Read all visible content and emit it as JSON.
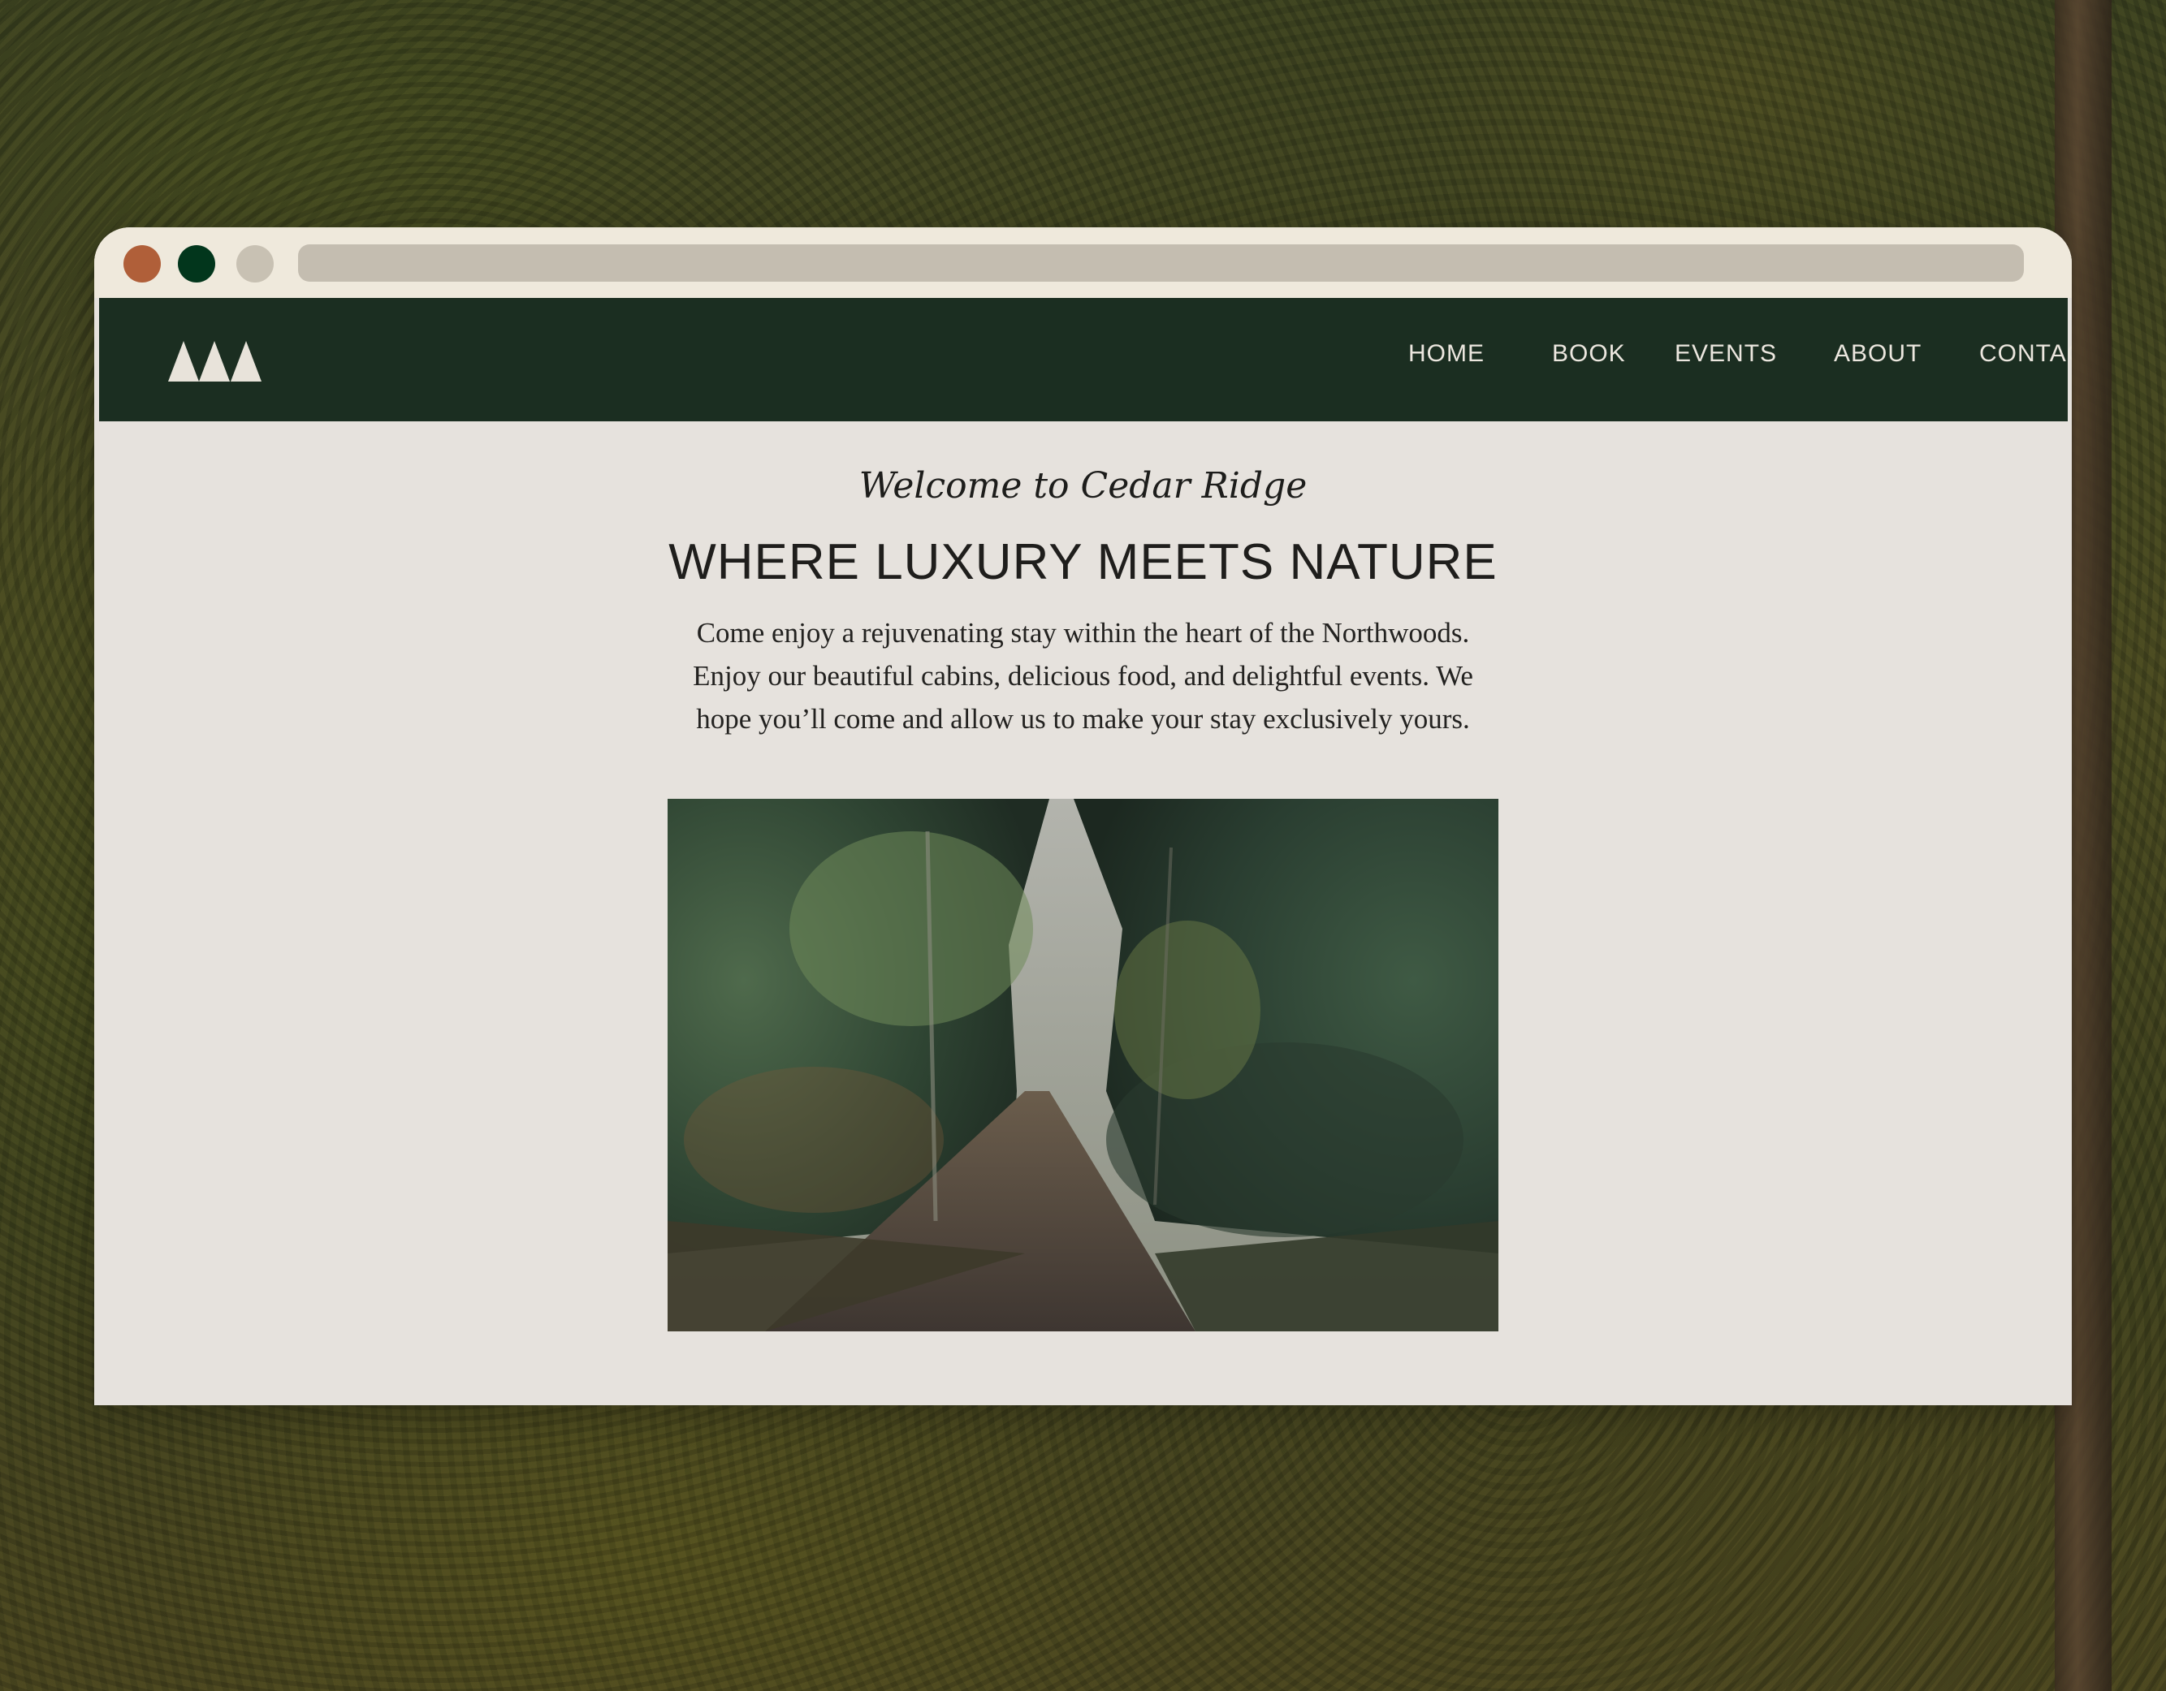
{
  "nav": {
    "items": [
      {
        "label": "HOME"
      },
      {
        "label": "BOOK"
      },
      {
        "label": "EVENTS"
      },
      {
        "label": "ABOUT"
      },
      {
        "label": "CONTACT"
      }
    ]
  },
  "hero": {
    "welcome": "Welcome to Cedar Ridge",
    "headline": "WHERE LUXURY MEETS NATURE",
    "intro": "Come enjoy a rejuvenating stay within the heart of the Northwoods. Enjoy our beautiful cabins, delicious food, and delightful events. We hope you’ll come and allow us to make your stay exclusively yours."
  },
  "colors": {
    "nav_bg": "#1b2e21",
    "page_bg": "#e6e2dd",
    "titlebar_bg": "#efe9dc",
    "dot_red": "#b05f39",
    "dot_green": "#02361c",
    "dot_gray": "#c8c1b3",
    "address_bar": "#c4bdb0"
  }
}
